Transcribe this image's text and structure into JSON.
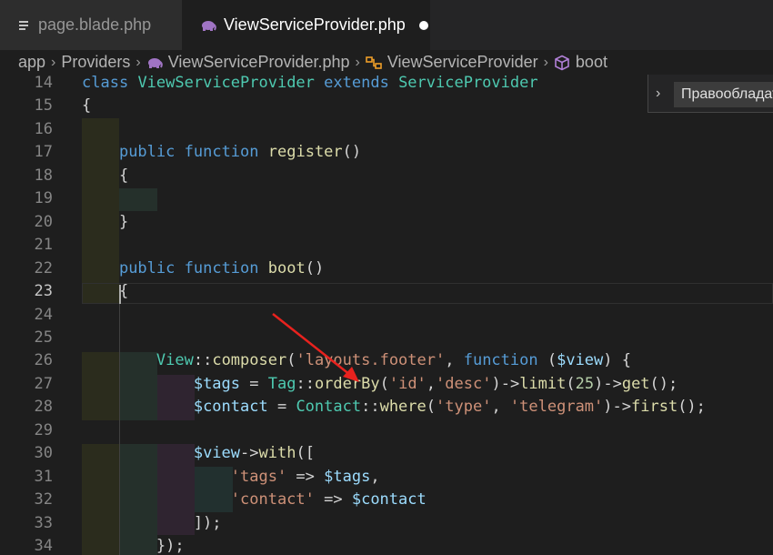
{
  "tabs": [
    {
      "label": "page.blade.php",
      "icon": "file-lines-icon",
      "active": false
    },
    {
      "label": "ViewServiceProvider.php",
      "icon": "php-elephant-icon",
      "active": true,
      "dirty": true
    }
  ],
  "breadcrumb": [
    {
      "label": "app",
      "icon": ""
    },
    {
      "label": "Providers",
      "icon": ""
    },
    {
      "label": "ViewServiceProvider.php",
      "icon": "php-elephant-icon"
    },
    {
      "label": "ViewServiceProvider",
      "icon": "class-icon"
    },
    {
      "label": "boot",
      "icon": "method-cube-icon"
    }
  ],
  "popup": {
    "label": "Правообладателям"
  },
  "editor": {
    "current_line": 23,
    "lines": [
      {
        "num": "14",
        "tokens": [
          [
            "k",
            "class"
          ],
          [
            "p",
            " "
          ],
          [
            "c",
            "ViewServiceProvider"
          ],
          [
            "p",
            " "
          ],
          [
            "k",
            "extends"
          ],
          [
            "p",
            " "
          ],
          [
            "c",
            "ServiceProvider"
          ]
        ]
      },
      {
        "num": "15",
        "tokens": [
          [
            "p",
            "{"
          ]
        ]
      },
      {
        "num": "16",
        "tokens": []
      },
      {
        "num": "17",
        "tokens": [
          [
            "p",
            "    "
          ],
          [
            "k",
            "public"
          ],
          [
            "p",
            " "
          ],
          [
            "k",
            "function"
          ],
          [
            "p",
            " "
          ],
          [
            "f",
            "register"
          ],
          [
            "p",
            "()"
          ]
        ]
      },
      {
        "num": "18",
        "tokens": [
          [
            "p",
            "    {"
          ]
        ]
      },
      {
        "num": "19",
        "tokens": []
      },
      {
        "num": "20",
        "tokens": [
          [
            "p",
            "    }"
          ]
        ]
      },
      {
        "num": "21",
        "tokens": []
      },
      {
        "num": "22",
        "tokens": [
          [
            "p",
            "    "
          ],
          [
            "k",
            "public"
          ],
          [
            "p",
            " "
          ],
          [
            "k",
            "function"
          ],
          [
            "p",
            " "
          ],
          [
            "f",
            "boot"
          ],
          [
            "p",
            "()"
          ]
        ]
      },
      {
        "num": "23",
        "tokens": [
          [
            "p",
            "    {"
          ]
        ]
      },
      {
        "num": "24",
        "tokens": []
      },
      {
        "num": "25",
        "tokens": []
      },
      {
        "num": "26",
        "tokens": [
          [
            "p",
            "        "
          ],
          [
            "c",
            "View"
          ],
          [
            "p",
            "::"
          ],
          [
            "f",
            "composer"
          ],
          [
            "p",
            "("
          ],
          [
            "s",
            "'layouts.footer'"
          ],
          [
            "p",
            ", "
          ],
          [
            "k",
            "function"
          ],
          [
            "p",
            " ("
          ],
          [
            "v",
            "$view"
          ],
          [
            "p",
            ") {"
          ]
        ]
      },
      {
        "num": "27",
        "tokens": [
          [
            "p",
            "            "
          ],
          [
            "v",
            "$tags"
          ],
          [
            "p",
            " = "
          ],
          [
            "c",
            "Tag"
          ],
          [
            "p",
            "::"
          ],
          [
            "f",
            "orderBy"
          ],
          [
            "p",
            "("
          ],
          [
            "s",
            "'id'"
          ],
          [
            "p",
            ","
          ],
          [
            "s",
            "'desc'"
          ],
          [
            "p",
            ")->"
          ],
          [
            "f",
            "limit"
          ],
          [
            "p",
            "("
          ],
          [
            "n",
            "25"
          ],
          [
            "p",
            ")->"
          ],
          [
            "f",
            "get"
          ],
          [
            "p",
            "();"
          ]
        ]
      },
      {
        "num": "28",
        "tokens": [
          [
            "p",
            "            "
          ],
          [
            "v",
            "$contact"
          ],
          [
            "p",
            " = "
          ],
          [
            "c",
            "Contact"
          ],
          [
            "p",
            "::"
          ],
          [
            "f",
            "where"
          ],
          [
            "p",
            "("
          ],
          [
            "s",
            "'type'"
          ],
          [
            "p",
            ", "
          ],
          [
            "s",
            "'telegram'"
          ],
          [
            "p",
            ")->"
          ],
          [
            "f",
            "first"
          ],
          [
            "p",
            "();"
          ]
        ]
      },
      {
        "num": "29",
        "tokens": []
      },
      {
        "num": "30",
        "tokens": [
          [
            "p",
            "            "
          ],
          [
            "v",
            "$view"
          ],
          [
            "p",
            "->"
          ],
          [
            "f",
            "with"
          ],
          [
            "p",
            "(["
          ]
        ]
      },
      {
        "num": "31",
        "tokens": [
          [
            "p",
            "                "
          ],
          [
            "s",
            "'tags'"
          ],
          [
            "p",
            " => "
          ],
          [
            "v",
            "$tags"
          ],
          [
            "p",
            ","
          ]
        ]
      },
      {
        "num": "32",
        "tokens": [
          [
            "p",
            "                "
          ],
          [
            "s",
            "'contact'"
          ],
          [
            "p",
            " => "
          ],
          [
            "v",
            "$contact"
          ]
        ]
      },
      {
        "num": "33",
        "tokens": [
          [
            "p",
            "            ]);"
          ]
        ]
      },
      {
        "num": "34",
        "tokens": [
          [
            "p",
            "        });"
          ]
        ]
      }
    ]
  },
  "colors": {
    "keyword": "#569cd6",
    "class": "#4ec9b0",
    "function": "#dcdcaa",
    "variable": "#9cdcfe",
    "string": "#ce9178",
    "number": "#b5cea8",
    "annotation_arrow": "#e8221e"
  }
}
